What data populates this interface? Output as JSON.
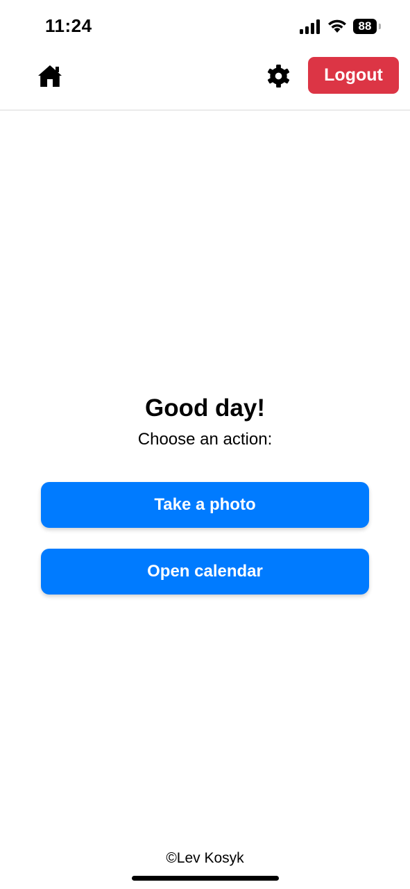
{
  "status_bar": {
    "time": "11:24",
    "battery_level": "88",
    "icons": [
      "signal-icon",
      "wifi-icon",
      "battery-icon"
    ]
  },
  "header": {
    "home_icon": "home-icon",
    "settings_icon": "gear-icon",
    "logout_label": "Logout"
  },
  "main": {
    "greeting": "Good day!",
    "subtitle": "Choose an action:",
    "actions": [
      {
        "label": "Take a photo"
      },
      {
        "label": "Open calendar"
      }
    ]
  },
  "footer": {
    "copyright": "©Lev Kosyk"
  },
  "colors": {
    "logout": "#dc3545",
    "primary": "#007bff",
    "background": "#ffffff"
  }
}
